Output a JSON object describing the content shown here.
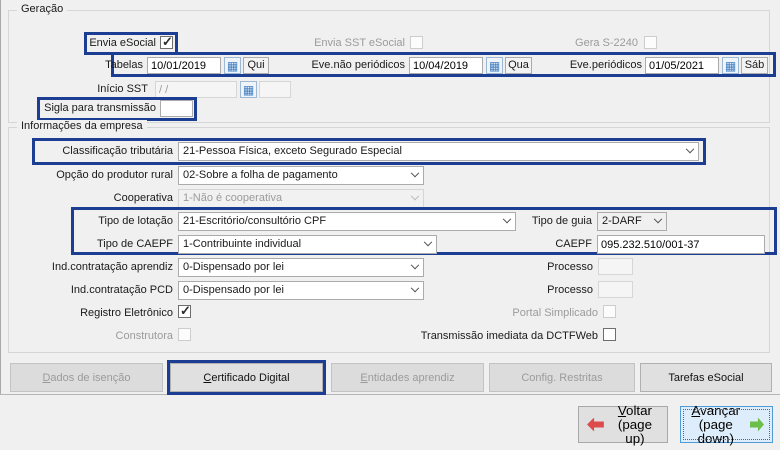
{
  "icons": {
    "calendar_grid": "▦"
  },
  "colors": {
    "highlight": "#1b3e92",
    "back_arrow": "#dd4b4b",
    "forward_arrow": "#6bbf48"
  },
  "geracao": {
    "title": "Geração",
    "envia_esocial": {
      "label": "Envia eSocial",
      "checked": true
    },
    "envia_sst": {
      "label": "Envia SST eSocial",
      "checked": false
    },
    "gera_s2240": {
      "label": "Gera S-2240",
      "checked": false
    },
    "tabelas": {
      "label": "Tabelas",
      "date": "10/01/2019",
      "day": "Qui"
    },
    "eve_nao_periodicos": {
      "label": "Eve.não periódicos",
      "date": "10/04/2019",
      "day": "Qua"
    },
    "eve_periodicos": {
      "label": "Eve.periódicos",
      "date": "01/05/2021",
      "day": "Sáb"
    },
    "inicio_sst": {
      "label": "Início SST",
      "date": "/ /",
      "day": ""
    },
    "sigla": {
      "label": "Sigla para transmissão",
      "value": ""
    }
  },
  "empresa": {
    "title": "Informações da empresa",
    "classificacao": {
      "label": "Classificação tributária",
      "value": "21-Pessoa Física, exceto Segurado Especial"
    },
    "produtor_rural": {
      "label": "Opção do produtor rural",
      "value": "02-Sobre a folha de pagamento"
    },
    "cooperativa": {
      "label": "Cooperativa",
      "value": "1-Não é cooperativa"
    },
    "tipo_lotacao": {
      "label": "Tipo de lotação",
      "value": "21-Escritório/consultório CPF"
    },
    "tipo_guia": {
      "label": "Tipo de guia",
      "value": "2-DARF"
    },
    "tipo_caepf": {
      "label": "Tipo de CAEPF",
      "value": "1-Contribuinte individual"
    },
    "caepf": {
      "label": "CAEPF",
      "value": "095.232.510/001-37"
    },
    "aprendiz": {
      "label": "Ind.contratação aprendiz",
      "value": "0-Dispensado por lei"
    },
    "processo1": {
      "label": "Processo",
      "value": ""
    },
    "pcd": {
      "label": "Ind.contratação PCD",
      "value": "0-Dispensado por lei"
    },
    "processo2": {
      "label": "Processo",
      "value": ""
    },
    "registro_eletronico": {
      "label": "Registro Eletrônico",
      "checked": true
    },
    "portal_simplicado": {
      "label": "Portal Simplicado",
      "checked": false
    },
    "construtora": {
      "label": "Construtora",
      "checked": false
    },
    "transmissao_dctfweb": {
      "label": "Transmissão imediata da DCTFWeb",
      "checked": false
    }
  },
  "buttons": {
    "dados_isencao": "Dados de isenção",
    "certificado_digital": "Certificado Digital",
    "entidades_aprendiz": "Entidades aprendiz",
    "config_restritas": "Config. Restritas",
    "tarefas_esocial": "Tarefas eSocial"
  },
  "nav": {
    "voltar": {
      "label": "Voltar",
      "sub": "(page up)"
    },
    "avancar": {
      "label": "Avançar",
      "sub": "(page down)"
    }
  }
}
